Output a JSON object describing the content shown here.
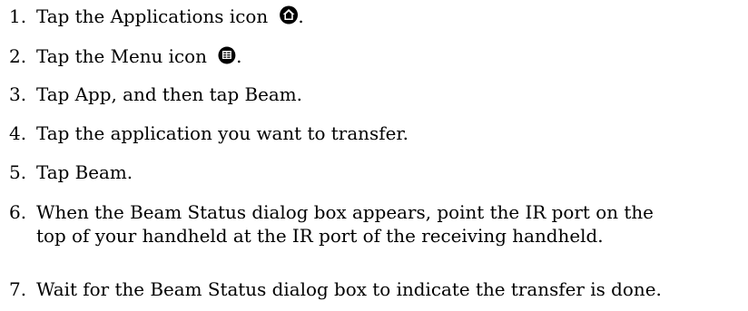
{
  "steps": [
    {
      "num": "1.",
      "text": "Tap the Applications icon",
      "suffix": ".",
      "icon": "applications-icon"
    },
    {
      "num": "2.",
      "text": "Tap the Menu icon",
      "suffix": ".",
      "icon": "menu-icon"
    },
    {
      "num": "3.",
      "text": "Tap App, and then tap Beam."
    },
    {
      "num": "4.",
      "text": "Tap the application you want to transfer."
    },
    {
      "num": "5.",
      "text": "Tap Beam."
    },
    {
      "num": "6.",
      "line1": "When the Beam Status dialog box appears, point the IR port on the",
      "line2": "top of your handheld at the IR port of the receiving handheld."
    },
    {
      "num": "7.",
      "text": "Wait for the Beam Status dialog box to indicate the transfer is done."
    }
  ]
}
